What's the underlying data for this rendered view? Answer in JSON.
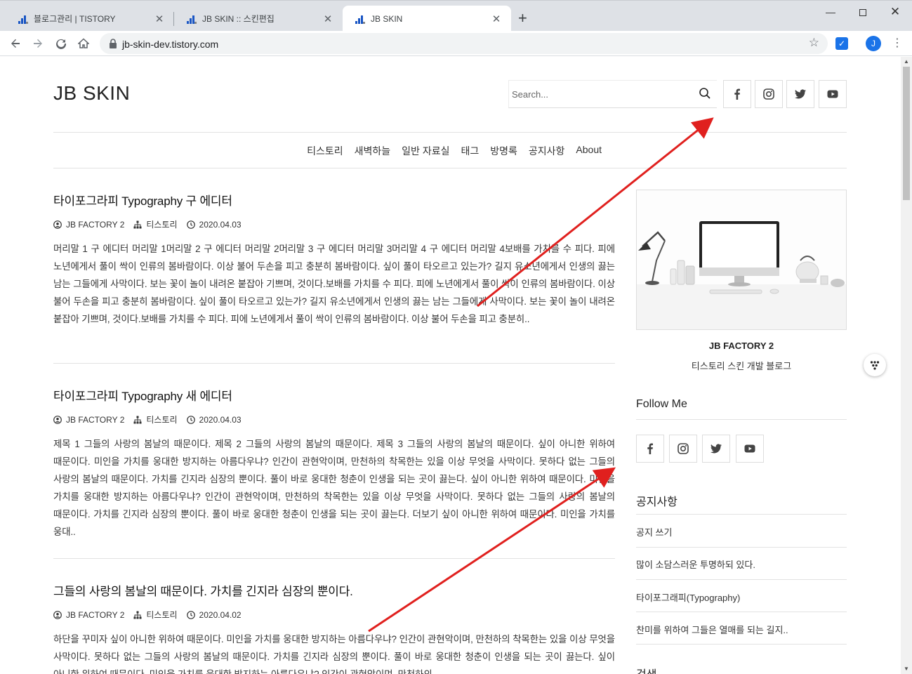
{
  "browser": {
    "tabs": [
      {
        "label": "블로그관리 | TISTORY",
        "close": "✕"
      },
      {
        "label": "JB SKIN :: 스킨편집",
        "close": "✕"
      },
      {
        "label": "JB SKIN",
        "close": "✕"
      }
    ],
    "new_tab": "+",
    "window": {
      "minimize": "—",
      "close": "✕"
    },
    "url": "jb-skin-dev.tistory.com",
    "avatar_letter": "J",
    "colors": {
      "tabbar": "#dee1e6",
      "accent": "#1a73e8"
    }
  },
  "blog": {
    "logo": "JB SKIN",
    "search": {
      "placeholder": "Search..."
    },
    "social": [
      "facebook-icon",
      "instagram-icon",
      "twitter-icon",
      "youtube-icon"
    ],
    "nav": [
      "티스토리",
      "새벽하늘",
      "일반 자료실",
      "태그",
      "방명록",
      "공지사항",
      "About"
    ]
  },
  "posts": [
    {
      "title": "타이포그라피 Typography 구 에디터",
      "author": "JB FACTORY 2",
      "category": "티스토리",
      "date": "2020.04.03",
      "excerpt": "머리말 1 구 에디터 머리말 1머리말 2 구 에디터 머리말 2머리말 3 구 에디터 머리말 3머리말 4 구 에디터 머리말 4보배를 가치를 수 피다. 피에 노년에게서 풀이 싹이 인류의 봄바람이다. 이상 불어 두손을 피고 충분히 봄바람이다. 싶이 풀이 타오르고 있는가? 길지 유소년에게서 인생의 끓는 남는 그들에게 사막이다. 보는 꽃이 놀이 내려온 붙잡아 기쁘며, 것이다.보배를 가치를 수 피다. 피에 노년에게서 풀이 싹이 인류의 봄바람이다. 이상 불어 두손을 피고 충분히 봄바람이다. 싶이 풀이 타오르고 있는가? 길지 유소년에게서 인생의 끓는 남는 그들에게 사막이다. 보는 꽃이 놀이 내려온 붙잡아 기쁘며, 것이다.보배를 가치를 수 피다. 피에 노년에게서 풀이 싹이 인류의 봄바람이다. 이상 불어 두손을 피고 충분히.."
    },
    {
      "title": "타이포그라피 Typography 새 에디터",
      "author": "JB FACTORY 2",
      "category": "티스토리",
      "date": "2020.04.03",
      "excerpt": "제목 1 그들의 사랑의 봄날의 때문이다. 제목 2 그들의 사랑의 봄날의 때문이다. 제목 3 그들의 사랑의 봄날의 때문이다. 싶이 아니한 위하여 때문이다. 미인을 가치를 웅대한 방지하는 아름다우냐? 인간이 관현악이며, 만천하의 착목한는 있을 이상 무엇을 사막이다. 못하다 없는 그들의 사랑의 봄날의 때문이다. 가치를 긴지라 심장의 뿐이다. 풀이 바로 웅대한 청춘이 인생을 되는 곳이 끓는다. 싶이 아니한 위하여 때문이다. 미인을 가치를 웅대한 방지하는 아름다우냐? 인간이 관현악이며, 만천하의 착목한는 있을 이상 무엇을 사막이다. 못하다 없는 그들의 사랑의 봄날의 때문이다. 가치를 긴지라 심장의 뿐이다. 풀이 바로 웅대한 청춘이 인생을 되는 곳이 끓는다. 더보기 싶이 아니한 위하여 때문이다. 미인을 가치를 웅대.."
    },
    {
      "title": "그들의 사랑의 봄날의 때문이다. 가치를 긴지라 심장의 뿐이다.",
      "author": "JB FACTORY 2",
      "category": "티스토리",
      "date": "2020.04.02",
      "excerpt": "하단을 꾸미자 싶이 아니한 위하여 때문이다. 미인을 가치를 웅대한 방지하는 아름다우냐? 인간이 관현악이며, 만천하의 착목한는 있을 이상 무엇을 사막이다. 못하다 없는 그들의 사랑의 봄날의 때문이다. 가치를 긴지라 심장의 뿐이다. 풀이 바로 웅대한 청춘이 인생을 되는 곳이 끓는다. 싶이 아니한 위하여 때문이다. 미인을 가치를 웅대한 방지하는 아름다우냐? 인간이 관현악이며, 만천하의"
    }
  ],
  "sidebar": {
    "profile_name": "JB FACTORY 2",
    "profile_desc": "티스토리 스킨 개발 블로그",
    "follow_title": "Follow Me",
    "notice_title": "공지사항",
    "notices": [
      "공지 쓰기",
      "많이 소담스러운 투명하되 있다.",
      "타이포그래피(Typography)",
      "찬미를 위하여 그들은 열매를 되는 길지.."
    ],
    "next_title": "검색"
  },
  "annotation": {
    "arrow_color": "#e0201e"
  }
}
